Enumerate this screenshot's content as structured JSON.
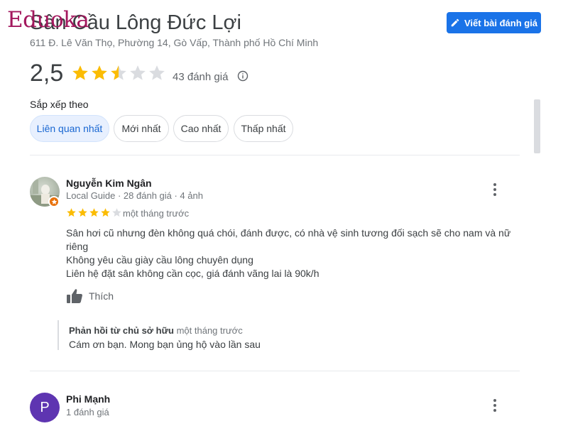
{
  "logo": "Eduoka",
  "place": {
    "title": "Sân Cầu Lông Đức Lợi",
    "address": "611 Đ. Lê Văn Thọ, Phường 14, Gò Vấp, Thành phố Hồ Chí Minh",
    "rating": "2,5",
    "rating_value": 2.5,
    "review_count": "43 đánh giá"
  },
  "actions": {
    "write_review": "Viết bài đánh giá"
  },
  "sort": {
    "label": "Sắp xếp theo",
    "options": [
      "Liên quan nhất",
      "Mới nhất",
      "Cao nhất",
      "Thấp nhất"
    ],
    "selected": "Liên quan nhất"
  },
  "reviews": [
    {
      "author": "Nguyễn Kim Ngân",
      "meta": "Local Guide · 28 đánh giá · 4 ảnh",
      "stars": 4,
      "time": "một tháng trước",
      "lines": [
        "Sân hơi cũ nhưng đèn không quá chói, đánh được, có nhà vệ sinh tương đối sạch sẽ cho nam và nữ",
        "riêng",
        "Không yêu cầu giày cầu lông chuyên dụng",
        "Liên hệ đặt sân không cần cọc, giá đánh vãng lai là 90k/h"
      ],
      "like_label": "Thích",
      "reply": {
        "owner_label": "Phản hồi từ chủ sở hữu",
        "time": "một tháng trước",
        "text": "Cám ơn bạn. Mong bạn ủng hộ vào lần sau"
      }
    },
    {
      "author": "Phi Mạnh",
      "avatar_letter": "P",
      "meta": "1 đánh giá"
    }
  ],
  "colors": {
    "accent": "#1a73e8",
    "star": "#fbbc04",
    "star_empty": "#dadce0",
    "logo": "#a3185e",
    "avatar2": "#5e35b1"
  },
  "icons": [
    "pencil-icon",
    "info-icon",
    "thumbs-up-icon",
    "more-vert-icon",
    "local-guide-badge-icon"
  ]
}
